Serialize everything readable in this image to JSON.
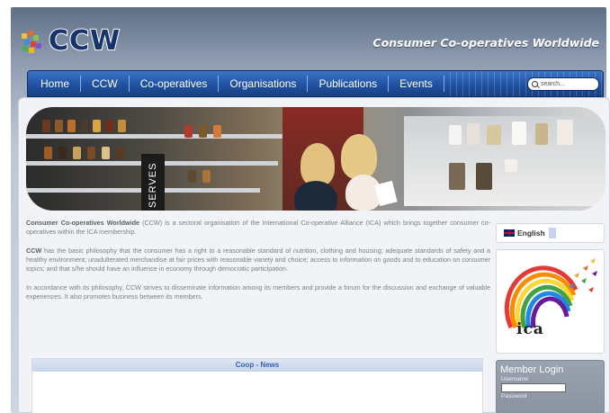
{
  "header": {
    "logo_text": "CCW",
    "tagline": "Consumer Co-operatives Worldwide"
  },
  "nav": {
    "items": [
      {
        "label": "Home"
      },
      {
        "label": "CCW"
      },
      {
        "label": "Co-operatives"
      },
      {
        "label": "Organisations"
      },
      {
        "label": "Publications"
      },
      {
        "label": "Events"
      }
    ],
    "search_placeholder": "search..."
  },
  "banner": {
    "sign_text": "SERVES"
  },
  "main": {
    "p1_bold": "Consumer Co-operatives Worldwide",
    "p1_rest": " (CCW) is a sectoral organisation of the International Co-operative Alliance (ICA) which brings together consumer co-operatives within the ICA membership.",
    "p2_bold": "CCW",
    "p2_rest": " has the basic philosophy that the consumer has a right to a reasonable standard of nutrition, clothing and housing; adequate standards of safety and a healthy environment; unadulterated merchandise at fair prices with reasonable variety and choice; access to information on goods and to education on consumer topics; and that s/he should have an influence in economy through democratic participation.",
    "p3": "In accordance with its philosophy, CCW strives to disseminate information among its members and provide a forum for the discussion and exchange of valuable experiences. It also promotes business between its members."
  },
  "news": {
    "title": "Coop - News"
  },
  "sidebar": {
    "language": "English",
    "ica_logo_text": "ica",
    "login": {
      "title": "Member Login",
      "username_label": "Username",
      "password_label": "Password"
    }
  },
  "colors": {
    "nav_blue": "#1f4f9e",
    "logo_blue": "#16336b",
    "news_title": "#3a5ea8"
  }
}
